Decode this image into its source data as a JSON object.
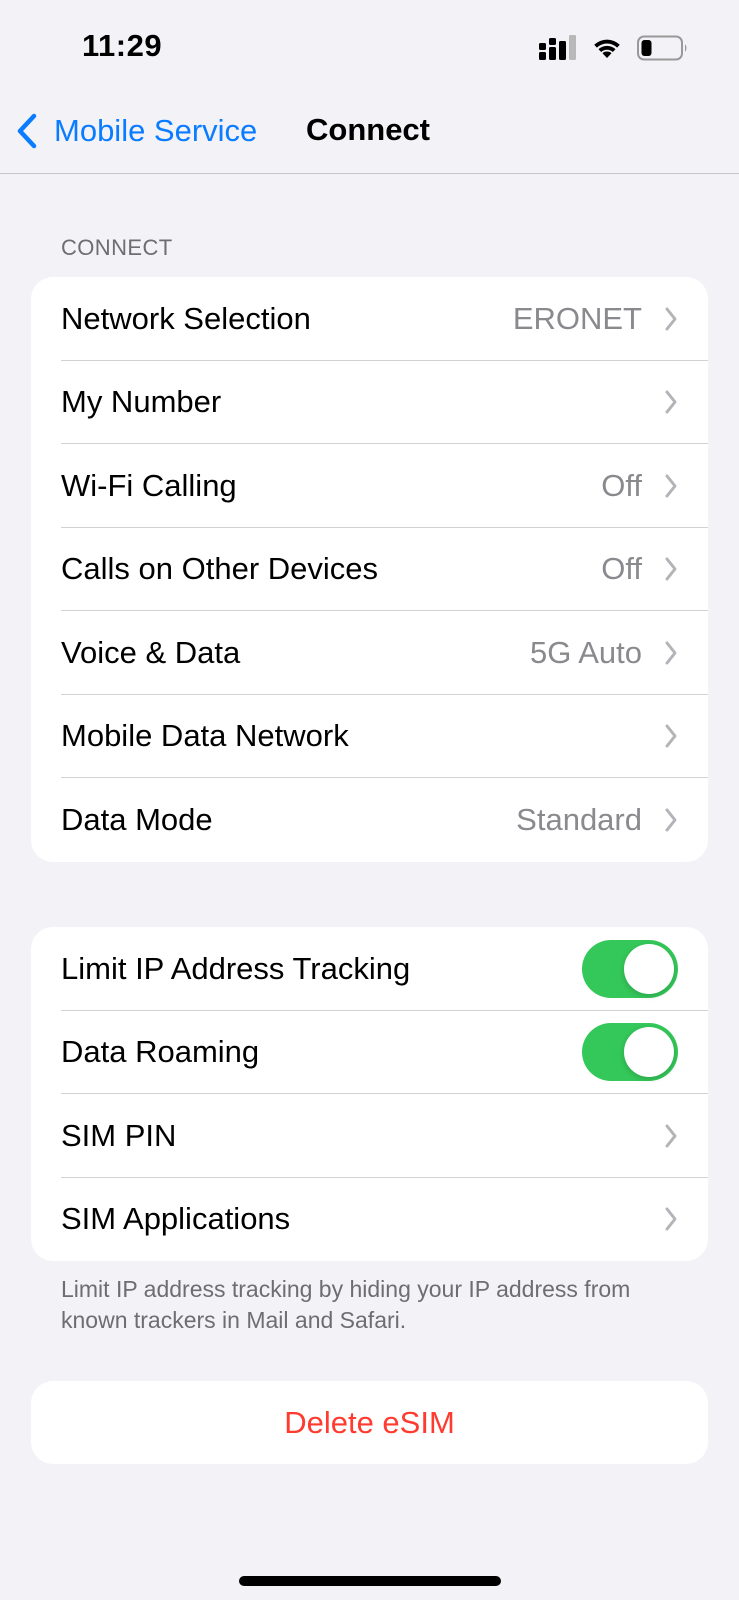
{
  "status_bar": {
    "time": "11:29",
    "icons": [
      "cellular-signal-icon",
      "wifi-icon",
      "battery-icon"
    ],
    "battery_level": 0.2
  },
  "nav": {
    "back_label": "Mobile Service",
    "title": "Connect"
  },
  "section_header": "CONNECT",
  "connect_rows": [
    {
      "label": "Network Selection",
      "value": "ERONET"
    },
    {
      "label": "My Number",
      "value": ""
    },
    {
      "label": "Wi-Fi Calling",
      "value": "Off"
    },
    {
      "label": "Calls on Other Devices",
      "value": "Off"
    },
    {
      "label": "Voice & Data",
      "value": "5G Auto"
    },
    {
      "label": "Mobile Data Network",
      "value": ""
    },
    {
      "label": "Data Mode",
      "value": "Standard"
    }
  ],
  "privacy_rows": [
    {
      "label": "Limit IP Address Tracking",
      "toggle": true
    },
    {
      "label": "Data Roaming",
      "toggle": true
    },
    {
      "label": "SIM PIN"
    },
    {
      "label": "SIM Applications"
    }
  ],
  "footer_note": "Limit IP address tracking by hiding your IP address from known trackers in Mail and Safari.",
  "delete_label": "Delete eSIM",
  "colors": {
    "accent": "#0a7cff",
    "toggle_on": "#34c759",
    "destructive": "#ff3b30",
    "background": "#f2f2f7",
    "secondary_text": "#8a8a8e"
  }
}
